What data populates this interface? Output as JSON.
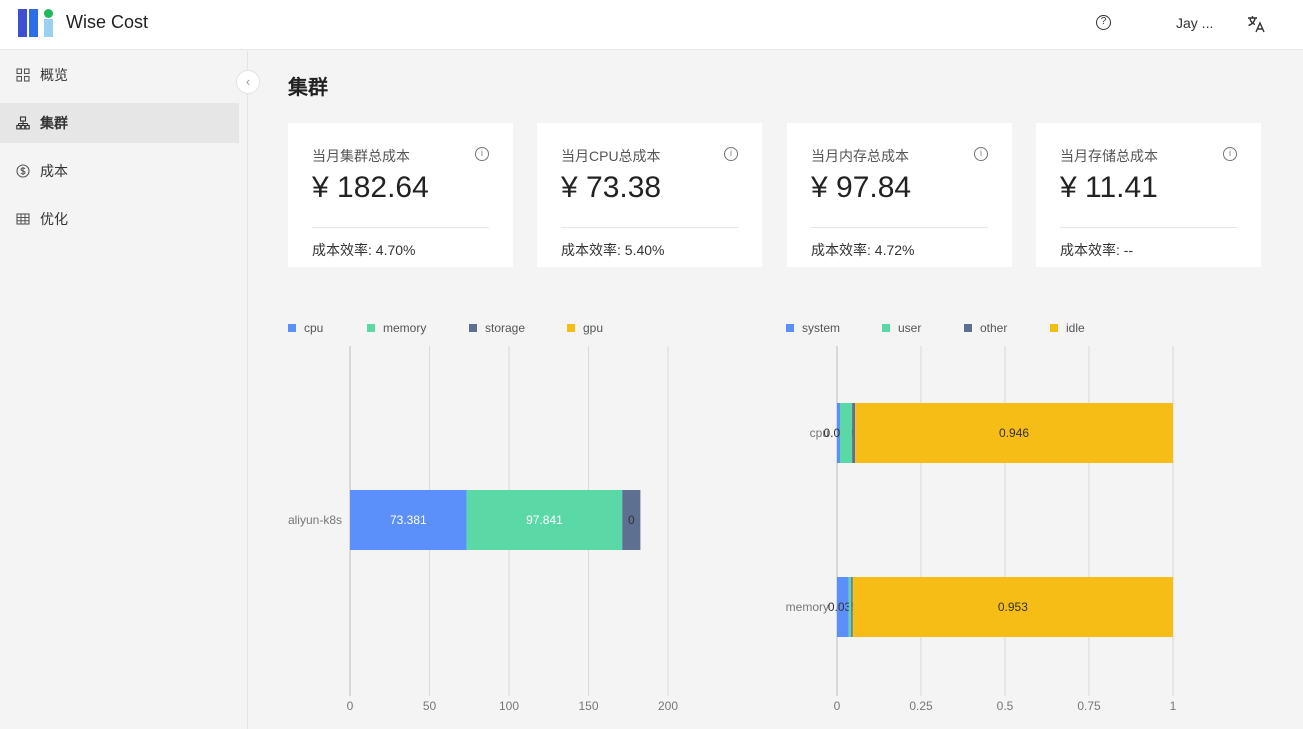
{
  "app": {
    "title": "Wise Cost",
    "user_name": "Jay ...",
    "help_glyph": "?"
  },
  "sidebar": {
    "collapse_glyph": "‹",
    "items": [
      {
        "label": "概览",
        "icon": "dashboard-grid-icon",
        "active": false
      },
      {
        "label": "集群",
        "icon": "cluster-icon",
        "active": true
      },
      {
        "label": "成本",
        "icon": "dollar-circle-icon",
        "active": false
      },
      {
        "label": "优化",
        "icon": "table-grid-icon",
        "active": false
      }
    ]
  },
  "page": {
    "title": "集群"
  },
  "cards": [
    {
      "label": "当月集群总成本",
      "value": "¥ 182.64",
      "efficiency": "成本效率: 4.70%"
    },
    {
      "label": "当月CPU总成本",
      "value": "¥ 73.38",
      "efficiency": "成本效率: 5.40%"
    },
    {
      "label": "当月内存总成本",
      "value": "¥ 97.84",
      "efficiency": "成本效率: 4.72%"
    },
    {
      "label": "当月存储总成本",
      "value": "¥ 11.41",
      "efficiency": "成本效率: --"
    }
  ],
  "colors": {
    "blue": "#5b8ff9",
    "green": "#5ad8a6",
    "slate": "#5d7092",
    "yellow": "#f6bd16"
  },
  "chart_data": [
    {
      "type": "bar",
      "orientation": "horizontal",
      "stacked": true,
      "categories": [
        "aliyun-k8s"
      ],
      "series": [
        {
          "name": "cpu",
          "values": [
            73.381
          ],
          "labels": [
            "73.381"
          ],
          "color": "#5b8ff9"
        },
        {
          "name": "memory",
          "values": [
            97.841
          ],
          "labels": [
            "97.841"
          ],
          "color": "#5ad8a6"
        },
        {
          "name": "storage",
          "values": [
            11.41
          ],
          "labels": [
            "0"
          ],
          "color": "#5d7092"
        },
        {
          "name": "gpu",
          "values": [
            0
          ],
          "labels": [
            ""
          ],
          "color": "#f6bd16"
        }
      ],
      "xticks": [
        "0",
        "50",
        "100",
        "150",
        "200"
      ],
      "xlim": [
        0,
        200
      ],
      "legend_position": "top-left",
      "grid": true
    },
    {
      "type": "bar",
      "orientation": "horizontal",
      "stacked": true,
      "categories": [
        "cpu",
        "memory"
      ],
      "series": [
        {
          "name": "system",
          "values": [
            0.009,
            0.035
          ],
          "labels": [
            "0.009",
            "0.035"
          ],
          "color": "#5b8ff9"
        },
        {
          "name": "user",
          "values": [
            0.036,
            0.007
          ],
          "labels": [
            "",
            ""
          ],
          "color": "#5ad8a6"
        },
        {
          "name": "other",
          "values": [
            0.009,
            0.005
          ],
          "labels": [
            "",
            ""
          ],
          "color": "#5d7092"
        },
        {
          "name": "idle",
          "values": [
            0.946,
            0.953
          ],
          "labels": [
            "0.946",
            "0.953"
          ],
          "color": "#f6bd16"
        }
      ],
      "xticks": [
        "0",
        "0.25",
        "0.5",
        "0.75",
        "1"
      ],
      "xlim": [
        0,
        1
      ],
      "legend_position": "top-left",
      "grid": true
    }
  ]
}
